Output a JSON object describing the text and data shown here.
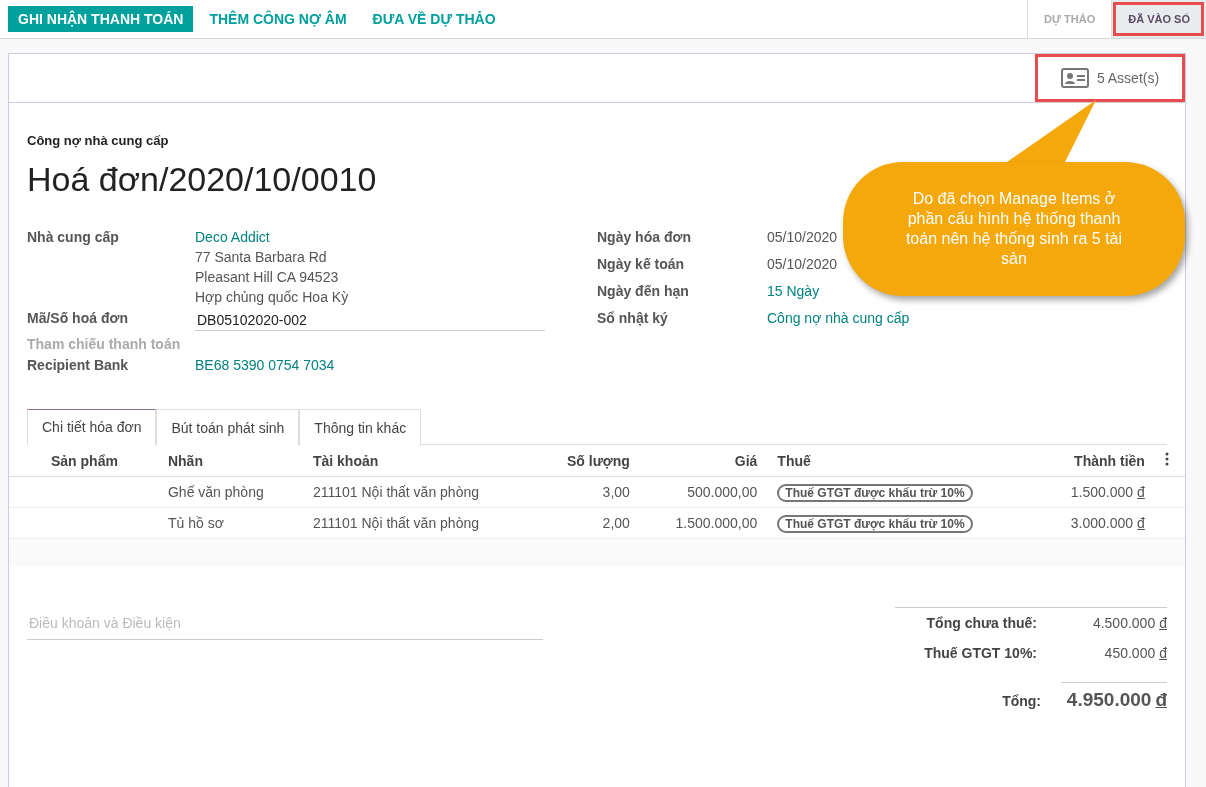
{
  "actions": [
    {
      "label": "GHI NHẬN THANH TOÁN",
      "kind": "primary"
    },
    {
      "label": "THÊM CÔNG NỢ ÂM",
      "kind": "link"
    },
    {
      "label": "ĐƯA VỀ DỰ THẢO",
      "kind": "link"
    }
  ],
  "statusbar": [
    {
      "label": "DỰ THẢO",
      "selected": false
    },
    {
      "label": "ĐÃ VÀO SỔ",
      "selected": true
    }
  ],
  "smart_button": {
    "label": "5 Asset(s)"
  },
  "callout": {
    "text": "Do đã chọn Manage Items ở phần cấu hình hệ thống thanh toán nên hệ thống sinh ra 5 tài sản"
  },
  "subtitle": "Công nợ nhà cung cấp",
  "title": "Hoá đơn/2020/10/0010",
  "left_fields": [
    {
      "label": "Nhà cung cấp",
      "kind": "partner",
      "values": [
        "Deco Addict",
        "77 Santa Barbara Rd",
        "Pleasant Hill CA 94523",
        "Hợp chủng quốc Hoa Kỳ"
      ]
    },
    {
      "label": "Mã/Số hoá đơn",
      "kind": "input",
      "values": [
        "DB05102020-002"
      ]
    },
    {
      "label": "Tham chiếu thanh toán",
      "kind": "empty"
    },
    {
      "label": "Recipient Bank",
      "kind": "link",
      "values": [
        "BE68 5390 0754 7034"
      ]
    }
  ],
  "right_fields": [
    {
      "label": "Ngày hóa đơn",
      "kind": "text",
      "value": "05/10/2020"
    },
    {
      "label": "Ngày kế toán",
      "kind": "text",
      "value": "05/10/2020"
    },
    {
      "label": "Ngày đến hạn",
      "kind": "link",
      "value": "15 Ngày"
    },
    {
      "label": "Sổ nhật ký",
      "kind": "link",
      "value": "Công nợ nhà cung cấp"
    }
  ],
  "tabs": [
    {
      "label": "Chi tiết hóa đơn",
      "selected": true
    },
    {
      "label": "Bút toán phát sinh",
      "selected": false
    },
    {
      "label": "Thông tin khác",
      "selected": false
    }
  ],
  "table": {
    "columns": [
      "Sản phẩm",
      "Nhãn",
      "Tài khoản",
      "Số lượng",
      "Giá",
      "Thuế",
      "Thành tiền"
    ],
    "rows": [
      {
        "label": "Ghế văn phòng",
        "account": "211101 Nội thất văn phòng",
        "qty": "3,00",
        "price": "500.000,00",
        "tax": "Thuế GTGT được khấu trừ 10%",
        "subtotal": "1.500.000",
        "currency": "đ"
      },
      {
        "label": "Tủ hồ sơ",
        "account": "211101 Nội thất văn phòng",
        "qty": "2,00",
        "price": "1.500.000,00",
        "tax": "Thuế GTGT được khấu trừ 10%",
        "subtotal": "3.000.000",
        "currency": "đ"
      }
    ]
  },
  "terms": {
    "placeholder": "Điều khoản và Điều kiện"
  },
  "totals": [
    {
      "label": "Tổng chưa thuế:",
      "amount": "4.500.000",
      "currency": "đ",
      "kind": "normal"
    },
    {
      "label": "Thuế GTGT 10%:",
      "amount": "450.000",
      "currency": "đ",
      "kind": "normal"
    },
    {
      "label": "Tổng:",
      "amount": "4.950.000",
      "currency": "đ",
      "kind": "grand"
    }
  ]
}
